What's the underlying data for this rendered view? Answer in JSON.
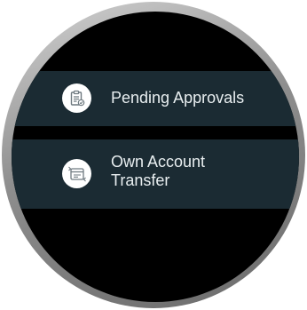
{
  "menu": {
    "items": [
      {
        "label": "Pending Approvals",
        "icon": "clipboard-check-icon"
      },
      {
        "label_line1": "Own Account",
        "label_line2": "Transfer",
        "icon": "transfer-icon"
      }
    ]
  },
  "colors": {
    "screen_background": "#000000",
    "item_background": "#1b2b33",
    "text": "#e8eef0",
    "icon_background": "#ffffff",
    "icon_stroke": "#6f7a80"
  }
}
